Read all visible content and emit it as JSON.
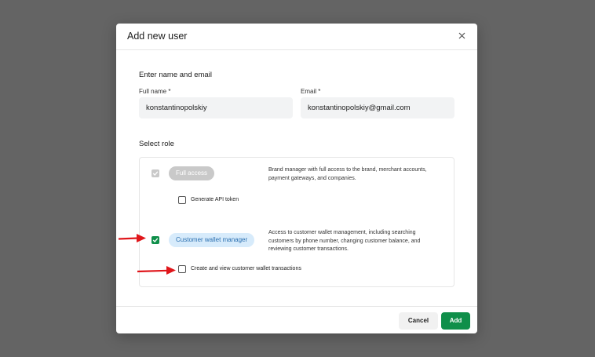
{
  "modal": {
    "title": "Add new user",
    "close_icon": "close-icon"
  },
  "name_section": {
    "title": "Enter name and email",
    "full_name_label": "Full name *",
    "full_name_value": "konstantinopolskiy",
    "email_label": "Email *",
    "email_value": "konstantinopolskiy@gmail.com"
  },
  "role_section": {
    "title": "Select role",
    "roles": [
      {
        "label": "Full access",
        "checked": true,
        "disabled": true,
        "description_lines": [
          "Brand manager with full access to the brand, merchant accounts,",
          "payment gateways, and companies."
        ],
        "permission": {
          "label": "Generate API token",
          "checked": false
        }
      },
      {
        "label": "Customer wallet manager",
        "checked": true,
        "disabled": false,
        "description_lines": [
          "Access to customer wallet management, including searching",
          "customers by phone number, changing customer balance, and",
          "reviewing customer transactions."
        ],
        "permission": {
          "label": "Create and view customer wallet transactions",
          "checked": false
        }
      }
    ]
  },
  "footer": {
    "cancel_label": "Cancel",
    "add_label": "Add"
  },
  "colors": {
    "accent": "#0f8f4a",
    "pill_active_bg": "#d7ebfb",
    "pill_active_text": "#2a6fb0",
    "annotation_arrow": "#e0161b"
  }
}
